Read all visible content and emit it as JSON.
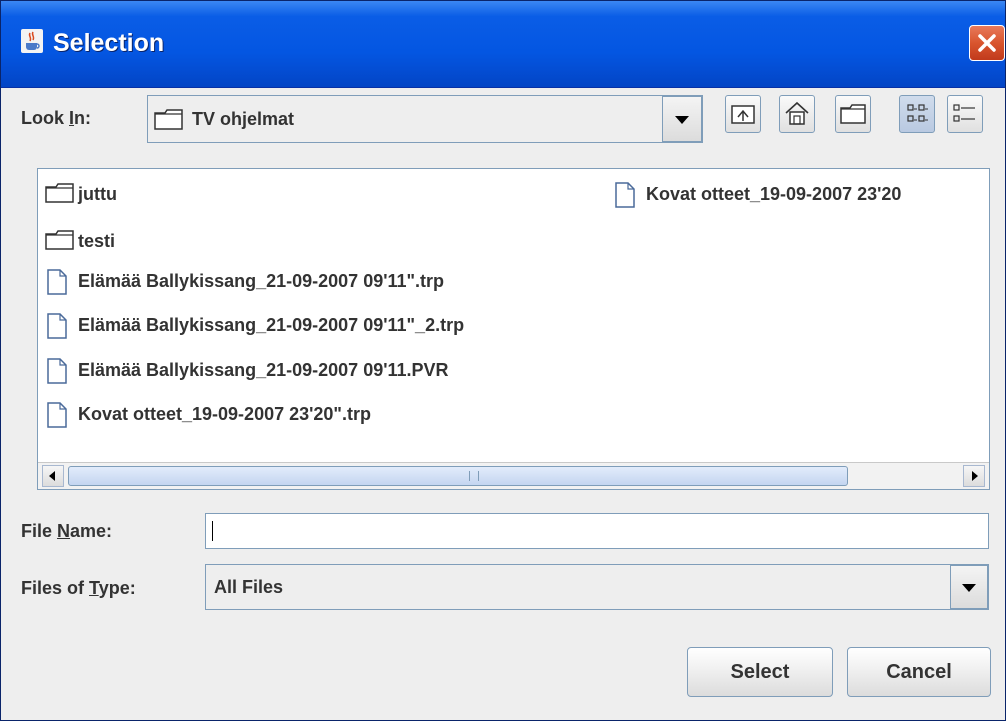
{
  "window": {
    "title": "Selection",
    "title_icon": "java-cup-icon",
    "close_icon": "close-icon"
  },
  "look_in": {
    "label_prefix": "Look ",
    "label_mnemonic": "I",
    "label_suffix": "n:",
    "selected": "TV ohjelmat",
    "selected_icon": "folder-icon"
  },
  "toolbar": [
    {
      "name": "up-one-level-button",
      "icon": "folder-up-icon"
    },
    {
      "name": "home-button",
      "icon": "home-icon"
    },
    {
      "name": "new-folder-button",
      "icon": "new-folder-icon"
    },
    {
      "name": "list-view-button",
      "icon": "list-view-icon",
      "pressed": true
    },
    {
      "name": "details-view-button",
      "icon": "details-view-icon",
      "pressed": false
    }
  ],
  "files": [
    {
      "name": "juttu",
      "type": "folder"
    },
    {
      "name": "testi",
      "type": "folder"
    },
    {
      "name": "Elämää Ballykissang_21-09-2007 09'11\".trp",
      "type": "file"
    },
    {
      "name": "Elämää Ballykissang_21-09-2007 09'11\"_2.trp",
      "type": "file"
    },
    {
      "name": "Elämää Ballykissang_21-09-2007 09'11.PVR",
      "type": "file"
    },
    {
      "name": "Kovat otteet_19-09-2007 23'20\".trp",
      "type": "file"
    },
    {
      "name": "Kovat otteet_19-09-2007 23'20",
      "type": "file"
    }
  ],
  "file_name": {
    "label_prefix": "File ",
    "label_mnemonic": "N",
    "label_suffix": "ame:",
    "value": ""
  },
  "file_type": {
    "label_prefix": "Files of ",
    "label_mnemonic": "T",
    "label_suffix": "ype:",
    "selected": "All Files"
  },
  "buttons": {
    "select": "Select",
    "cancel": "Cancel"
  }
}
